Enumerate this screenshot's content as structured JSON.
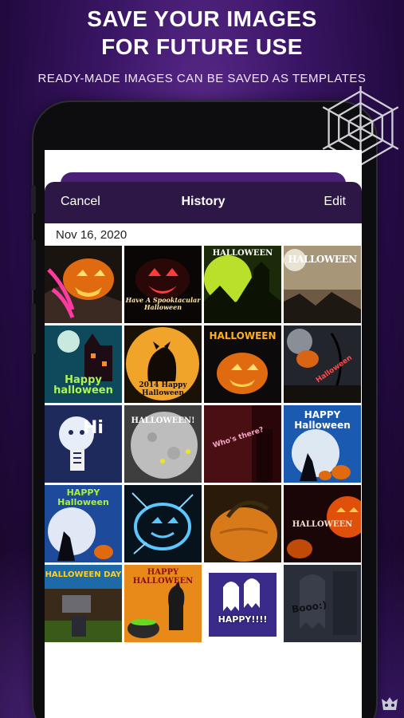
{
  "promo": {
    "title_line1": "SAVE YOUR IMAGES",
    "title_line2": "FOR FUTURE USE",
    "subtitle": "READY-MADE IMAGES CAN BE SAVED AS TEMPLATES"
  },
  "nav": {
    "cancel": "Cancel",
    "title": "History",
    "edit": "Edit"
  },
  "section_date": "Nov 16, 2020",
  "thumbnails": [
    {
      "caption": ""
    },
    {
      "caption": "Have A Spooktacular Halloween"
    },
    {
      "caption": "HALLOWEEN"
    },
    {
      "caption": "HALLOWEEN"
    },
    {
      "caption": "Happy halloween"
    },
    {
      "caption": "2014 Happy Halloween"
    },
    {
      "caption": "HALLOWEEN"
    },
    {
      "caption": "Halloween"
    },
    {
      "caption": "Hi"
    },
    {
      "caption": "HALLOWEEN!"
    },
    {
      "caption": "Who's there?"
    },
    {
      "caption": "HAPPY Halloween"
    },
    {
      "caption": "HAPPY Halloween"
    },
    {
      "caption": ""
    },
    {
      "caption": ""
    },
    {
      "caption": "HALLOWEEN"
    },
    {
      "caption": "HALLOWEEN DAY"
    },
    {
      "caption": "HAPPY HALLOWEEN"
    },
    {
      "caption": "HAPPY!!!!"
    },
    {
      "caption": "Booo:)"
    }
  ],
  "colors": {
    "nav_bg": "#2d1747",
    "accent_purple": "#5a2a8a"
  }
}
